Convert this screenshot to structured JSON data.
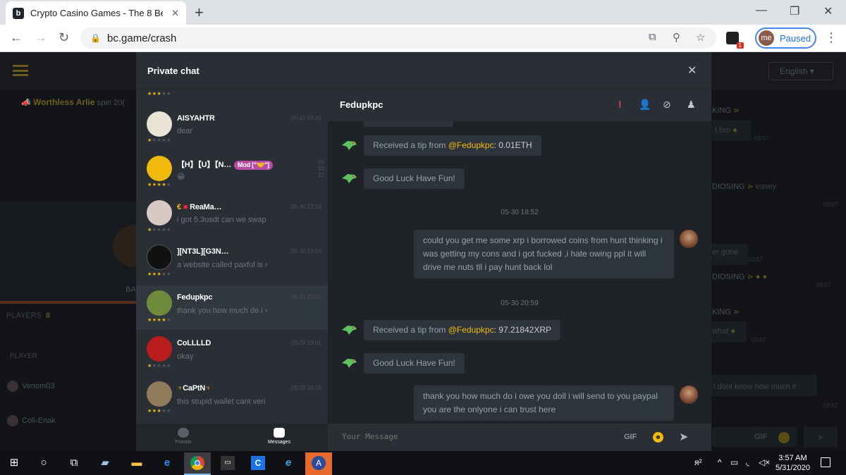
{
  "browser": {
    "tab_title": "Crypto Casino Games - The 8 Bes",
    "url": "bc.game/crash",
    "profile_initials": "me",
    "profile_status": "Paused",
    "extension_badge": "1"
  },
  "site": {
    "language": "English",
    "ticker_user": "Worthless Arlie",
    "ticker_text": "spin 20(",
    "players_label": "PLAYERS",
    "players_count": "8",
    "player_header": "PLAYER",
    "player_rows": [
      "Venom03",
      "Coli-Enak"
    ],
    "left_fragment": "BA",
    "right_chat": [
      {
        "name": "KING",
        "text": "",
        "time": ""
      },
      {
        "name": "",
        "text": "t bro",
        "time": "03:57"
      },
      {
        "name": "DIOSING",
        "text": "easey",
        "time": "03:57"
      },
      {
        "name": "",
        "text": "er gone",
        "time": "03:57"
      },
      {
        "name": "DIOSING",
        "text": "",
        "time": "03:57"
      },
      {
        "name": "KING",
        "text": "",
        "time": ""
      },
      {
        "name": "",
        "text": "what",
        "time": "03:57"
      },
      {
        "name": "",
        "text": "i dont know how much it",
        "time": "03:57"
      }
    ],
    "right_gif": "GIF"
  },
  "modal": {
    "title": "Private chat",
    "contacts": [
      {
        "name": "AISYAHTR",
        "msg": "dear",
        "time": "05-31 03:34",
        "stars": 1
      },
      {
        "name": "【H】【U】【N…",
        "badge": "Mod [\"🤝\"]",
        "msg": "😁",
        "time": "05-30 22",
        "stars": 4
      },
      {
        "name": "ReaMa…",
        "msg": "i got 5.3usdt can we swap",
        "time": "05-30 22:13",
        "stars": 1
      },
      {
        "name": "][NT3L][G3N…",
        "msg": "a website called paxful is ›",
        "time": "05-30 21:04",
        "stars": 3
      },
      {
        "name": "Fedupkpc",
        "msg": "thank you how much do i ›",
        "time": "05-30 21:02",
        "stars": 4
      },
      {
        "name": "CoLLLLD",
        "msg": "okay",
        "time": "05-29 19:01",
        "stars": 1
      },
      {
        "name": "CaPtN",
        "msg": "this stupid wallet cant veri",
        "time": "05-29 18:19",
        "stars": 3
      }
    ],
    "tabs": {
      "friends": "Friends",
      "messages": "Messages"
    },
    "conversation": {
      "name": "Fedupkpc",
      "messages": [
        {
          "type": "system",
          "prefix": "Received a tip from ",
          "mention": "@Fedupkpc",
          "value": ": 0.01ETH"
        },
        {
          "type": "system_plain",
          "text": "Good Luck Have Fun!"
        },
        {
          "type": "date",
          "text": "05-30 18:52"
        },
        {
          "type": "user",
          "text": "could you get me some xrp i borrowed coins from hunt thinking i was getting my cons and i got fucked ,i hate owing ppl it will drive me nuts tll i pay hunt back lol"
        },
        {
          "type": "date",
          "text": "05-30 20:59"
        },
        {
          "type": "system",
          "prefix": "Received a tip from ",
          "mention": "@Fedupkpc",
          "value": ": 97.21842XRP"
        },
        {
          "type": "system_plain",
          "text": "Good Luck Have Fun!"
        },
        {
          "type": "user",
          "text": "thank you how much do i owe you doll i will send to you paypal you are the onlyone i can trust here"
        }
      ],
      "input_placeholder": "Your Message",
      "gif_label": "GIF"
    }
  },
  "taskbar": {
    "time": "3:57 AM",
    "date": "5/31/2020"
  }
}
